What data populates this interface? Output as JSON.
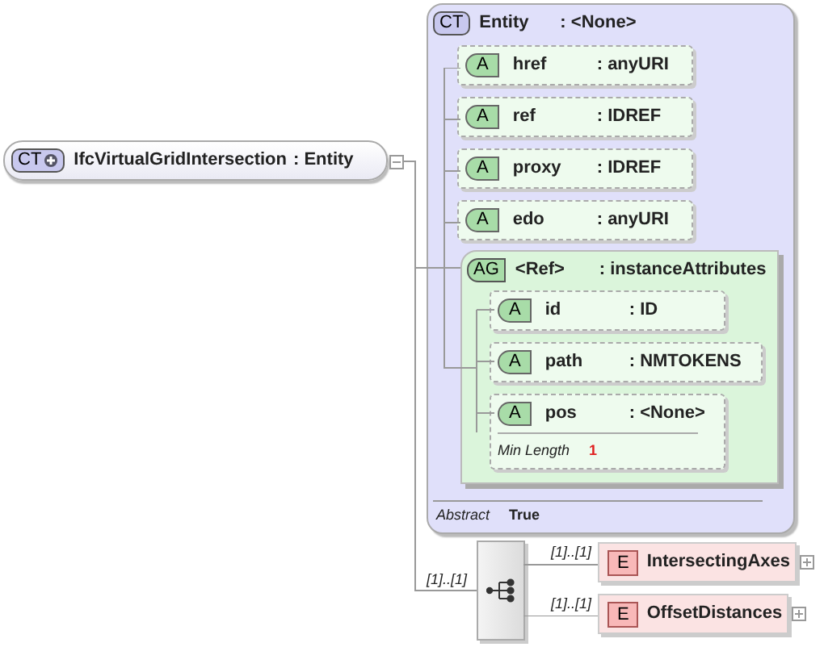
{
  "root": {
    "badge": "CT",
    "name": "IfcVirtualGridIntersection",
    "type": ": Entity",
    "expanded": true
  },
  "entity": {
    "badge": "CT",
    "name": "Entity",
    "type": ": <None>",
    "attributes": [
      {
        "badge": "A",
        "name": "href",
        "type": ": anyURI"
      },
      {
        "badge": "A",
        "name": "ref",
        "type": ": IDREF"
      },
      {
        "badge": "A",
        "name": "proxy",
        "type": ": IDREF"
      },
      {
        "badge": "A",
        "name": "edo",
        "type": ": anyURI"
      }
    ],
    "attribute_group": {
      "badge": "AG",
      "name": "<Ref>",
      "type": ": instanceAttributes",
      "attributes": [
        {
          "badge": "A",
          "name": "id",
          "type": ": ID"
        },
        {
          "badge": "A",
          "name": "path",
          "type": ": NMTOKENS"
        },
        {
          "badge": "A",
          "name": "pos",
          "type": ": <None>",
          "facets": [
            {
              "label": "Min Length",
              "value": "1"
            }
          ]
        }
      ]
    },
    "properties": [
      {
        "label": "Abstract",
        "value": "True"
      }
    ]
  },
  "sequence": {
    "cardinality": "[1]..[1]",
    "elements": [
      {
        "badge": "E",
        "name": "IntersectingAxes",
        "cardinality": "[1]..[1]",
        "expanded": false
      },
      {
        "badge": "E",
        "name": "OffsetDistances",
        "cardinality": "[1]..[1]",
        "expanded": false
      }
    ]
  }
}
